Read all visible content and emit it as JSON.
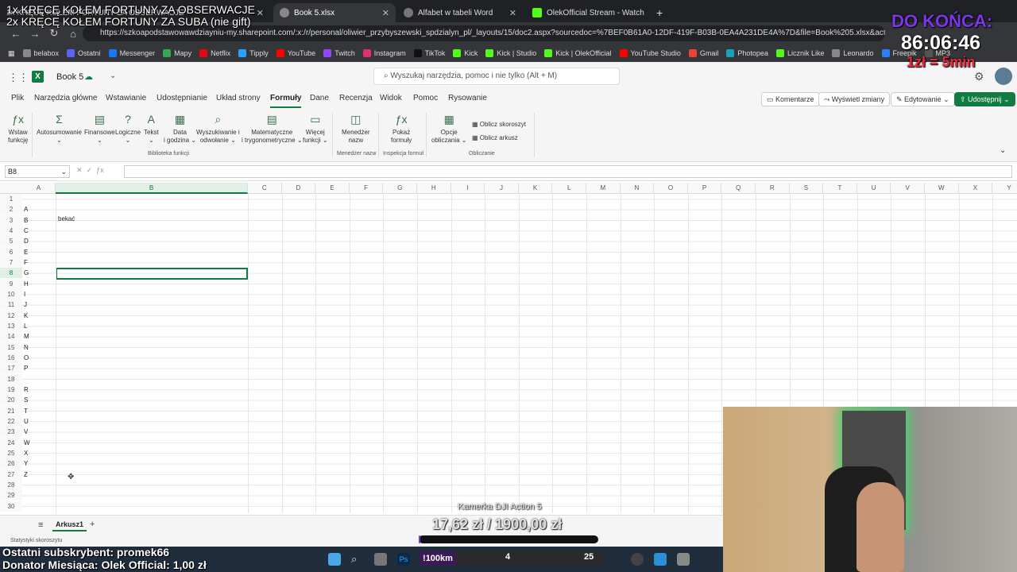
{
  "browser": {
    "tabs": [
      {
        "title": "1x KRĘCĘ KOŁEM FORTUNY ZA OBSERWACJE",
        "active": false
      },
      {
        "title": "Book 5.xlsx",
        "active": true
      },
      {
        "title": "Alfabet w tabeli Word",
        "active": false
      },
      {
        "title": "OlekOfficial Stream - Watch Li...",
        "active": false
      }
    ],
    "url": "https://szkoapodstawowawdziayniu-my.sharepoint.com/:x:/r/personal/oliwier_przybyszewski_spdzialyn_pl/_layouts/15/doc2.aspx?sourcedoc=%7BEF0B61A0-12DF-419F-B03B-0EA4A231DE4A%7D&file=Book%205.xlsx&action=editNew&...",
    "bookmarks": [
      "belabox",
      "Ostatni",
      "Messenger",
      "Mapy",
      "Netflix",
      "Tipply",
      "YouTube",
      "Twitch",
      "Instagram",
      "TikTok",
      "Kick",
      "Kick | Studio",
      "Kick | OlekOfficial",
      "YouTube Studio",
      "Gmail",
      "Photopea",
      "Licznik Like",
      "Leonardo",
      "Freepik",
      "MP3"
    ],
    "bookmark_colors": [
      "#888",
      "#5865f2",
      "#1877f2",
      "#34a853",
      "#e50914",
      "#2aa0ff",
      "#ff0000",
      "#9146ff",
      "#e1306c",
      "#111",
      "#53fc18",
      "#53fc18",
      "#53fc18",
      "#ff0000",
      "#ea4335",
      "#17a2b8",
      "#53fc18",
      "#888",
      "#2d7ff9",
      "#555"
    ]
  },
  "excel": {
    "book_name": "Book 5",
    "search_placeholder": "Wyszukaj narzędzia, pomoc i nie tylko (Alt + M)",
    "ribbon_tabs": [
      "Plik",
      "Narzędzia główne",
      "Wstawianie",
      "Udostępnianie",
      "Układ strony",
      "Formuły",
      "Dane",
      "Recenzja",
      "Widok",
      "Pomoc",
      "Rysowanie"
    ],
    "active_tab": "Formuły",
    "header_buttons": {
      "comments": "Komentarze",
      "changes": "Wyświetl zmiany",
      "editing": "Edytowanie",
      "share": "Udostępnij"
    },
    "ribbon": {
      "insert_function": [
        "Wstaw",
        "funkcję"
      ],
      "autosum": "Autosumowanie",
      "financial": "Finansowe",
      "logical": "Logiczne",
      "text": "Tekst",
      "datetime": [
        "Data",
        "i godzina"
      ],
      "lookup": [
        "Wyszukiwanie i",
        "odwołanie"
      ],
      "math": [
        "Matematyczne",
        "i trygonometryczne"
      ],
      "more": [
        "Więcej",
        "funkcji"
      ],
      "name_manager": [
        "Menedżer",
        "nazw"
      ],
      "show_formulas": [
        "Pokaż",
        "formuły"
      ],
      "calc_options": [
        "Opcje",
        "obliczania"
      ],
      "calc_workbook": "Oblicz skoroszyt",
      "calc_sheet": "Oblicz arkusz",
      "group_library": "Biblioteka funkcji",
      "group_names": "Menedżer nazw",
      "group_audit": "Inspekcja formuł",
      "group_calc": "Obliczanie"
    },
    "name_box": "B8",
    "columns": [
      "A",
      "B",
      "C",
      "D",
      "E",
      "F",
      "G",
      "H",
      "I",
      "J",
      "K",
      "L",
      "M",
      "N",
      "O",
      "P",
      "Q",
      "R",
      "S",
      "T",
      "U",
      "V",
      "W",
      "X",
      "Y"
    ],
    "selected_column": "B",
    "selected_row": 8,
    "rows": [
      {
        "n": "1",
        "a": ""
      },
      {
        "n": "2",
        "a": "A"
      },
      {
        "n": "3",
        "a": "B"
      },
      {
        "n": "4",
        "a": "C"
      },
      {
        "n": "5",
        "a": "D"
      },
      {
        "n": "6",
        "a": "E"
      },
      {
        "n": "7",
        "a": "F"
      },
      {
        "n": "8",
        "a": "G"
      },
      {
        "n": "9",
        "a": "H"
      },
      {
        "n": "10",
        "a": "I"
      },
      {
        "n": "11",
        "a": "J"
      },
      {
        "n": "12",
        "a": "K"
      },
      {
        "n": "13",
        "a": "L"
      },
      {
        "n": "14",
        "a": "M"
      },
      {
        "n": "15",
        "a": "N"
      },
      {
        "n": "16",
        "a": "O"
      },
      {
        "n": "17",
        "a": "P"
      },
      {
        "n": "18",
        "a": ""
      },
      {
        "n": "19",
        "a": "R"
      },
      {
        "n": "20",
        "a": "S"
      },
      {
        "n": "21",
        "a": "T"
      },
      {
        "n": "22",
        "a": "U"
      },
      {
        "n": "23",
        "a": "V"
      },
      {
        "n": "24",
        "a": "W"
      },
      {
        "n": "25",
        "a": "X"
      },
      {
        "n": "26",
        "a": "Y"
      },
      {
        "n": "27",
        "a": "Z"
      },
      {
        "n": "28",
        "a": ""
      },
      {
        "n": "29",
        "a": ""
      },
      {
        "n": "30",
        "a": ""
      }
    ],
    "cell_b3": "bekać",
    "sheet_name": "Arkusz1",
    "status": "Statystyki skoroszytu"
  },
  "overlay": {
    "wheel_line1": "1x KRĘCĘ KOŁEM FORTUNY ZA OBSERWACJE",
    "wheel_line2": "2x KRĘCĘ KOŁEM FORTUNY ZA SUBA (nie gift)",
    "do_konca": "DO KOŃCA:",
    "timer": "86:06:46",
    "rate": "1zł = 5min",
    "camera_label": "Kamerka DJI Action 5",
    "money": "17,62 zł / 1900,00 zł",
    "money_progress": 0.0093,
    "last_sub": "Ostatni subskrybent: promek66",
    "donor": "Donator Miesiąca: Olek Official: 1,00 zł"
  },
  "taskbar": {
    "item1": "!100km",
    "item2": "4",
    "item3": "25"
  }
}
